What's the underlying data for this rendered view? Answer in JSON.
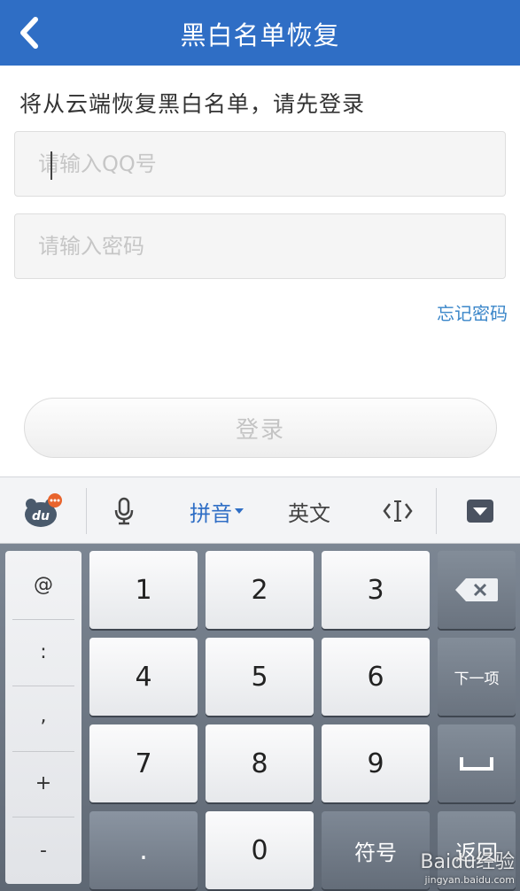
{
  "header": {
    "title": "黑白名单恢复",
    "back_icon": "chevron-left-icon"
  },
  "hint": "将从云端恢复黑白名单，请先登录",
  "form": {
    "qq_placeholder": "请输入QQ号",
    "password_placeholder": "请输入密码",
    "forgot_label": "忘记密码",
    "login_label": "登录"
  },
  "keyboard": {
    "toolbar": {
      "logo_icon": "du-bear-logo-icon",
      "mic_icon": "microphone-icon",
      "pinyin_label": "拼音",
      "english_label": "英文",
      "cursor_icon": "cursor-move-icon",
      "hide_icon": "hide-keyboard-icon"
    },
    "symbols": [
      "@",
      ":",
      ",",
      "+",
      "-"
    ],
    "digits": [
      "1",
      "2",
      "3",
      "4",
      "5",
      "6",
      "7",
      "8",
      "9",
      "0"
    ],
    "dot_label": ".",
    "next_label": "下一项",
    "symbol_label": "符号",
    "return_label": "返回",
    "delete_icon": "backspace-icon",
    "space_icon": "space-icon"
  },
  "watermark": {
    "text": "Baidu经验",
    "sub": "jingyan.baidu.com"
  },
  "colors": {
    "header": "#2f6ec5",
    "link": "#3a86c9"
  }
}
